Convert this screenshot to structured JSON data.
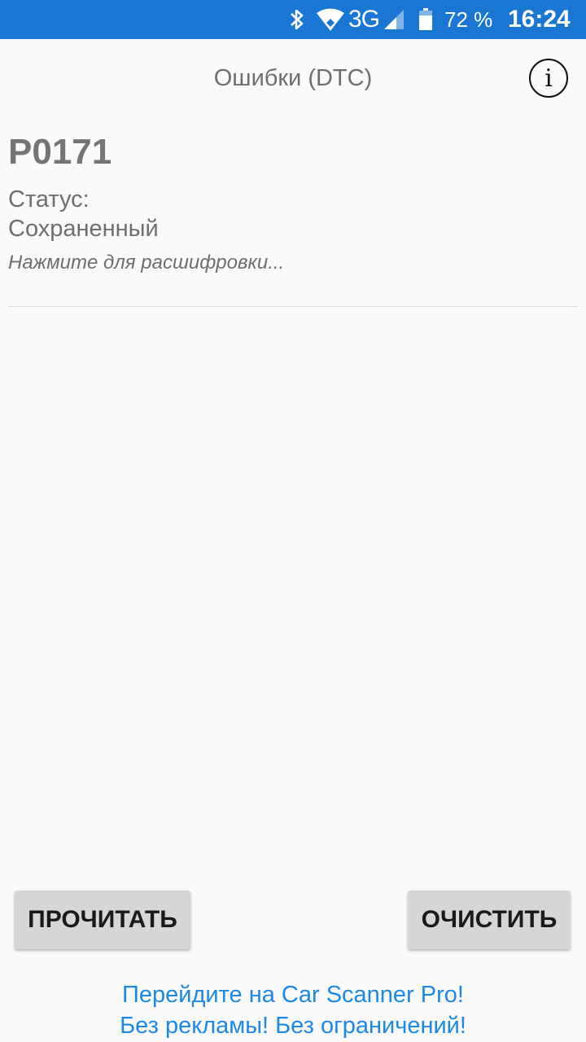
{
  "statusbar": {
    "network": "3G",
    "battery_percent": "72 %",
    "battery_level": 0.72,
    "time": "16:24",
    "icons": [
      "bluetooth-icon",
      "wifi-icon",
      "signal-icon",
      "battery-icon"
    ],
    "background_color": "#1976d2"
  },
  "header": {
    "title": "Ошибки (DTC)",
    "info_icon_glyph": "i"
  },
  "dtc": {
    "code": "P0171",
    "status_label": "Статус:",
    "status_value": "Сохраненный",
    "hint": "Нажмите для расшифровки..."
  },
  "actions": {
    "read_label": "ПРОЧИТАТЬ",
    "clear_label": "ОЧИСТИТЬ"
  },
  "promo": {
    "line1": "Перейдите на Car Scanner Pro!",
    "line2": "Без рекламы! Без ограничений!",
    "color": "#1e88e5"
  }
}
